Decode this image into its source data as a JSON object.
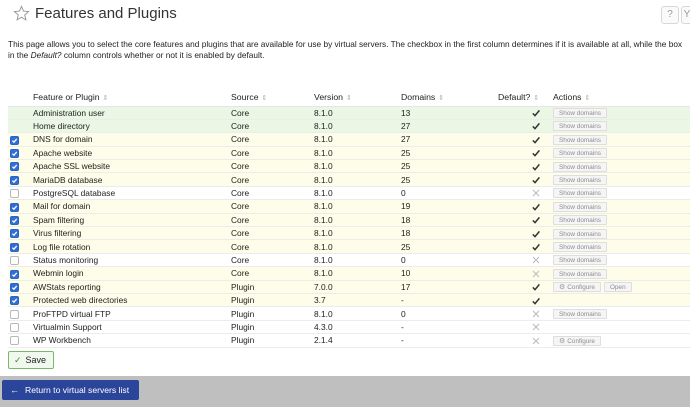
{
  "header": {
    "title": "Features and Plugins",
    "help_label": "?",
    "search_label": "Y"
  },
  "description": {
    "text_before": "This page allows you to select the core features and plugins that are available for use by virtual servers. The checkbox in the first column determines if it is available at all, while the box in the ",
    "emphasis": "Default?",
    "text_after": " column controls whether or not it is enabled by default."
  },
  "table": {
    "columns": [
      "Feature or Plugin",
      "Source",
      "Version",
      "Domains",
      "Default?",
      "Actions"
    ],
    "rows": [
      {
        "enabled": null,
        "name": "Administration user",
        "source": "Core",
        "version": "8.1.0",
        "domains": "13",
        "default": "check",
        "actions": [
          "Show domains"
        ],
        "tint": "green"
      },
      {
        "enabled": null,
        "name": "Home directory",
        "source": "Core",
        "version": "8.1.0",
        "domains": "27",
        "default": "check",
        "actions": [
          "Show domains"
        ],
        "tint": "green"
      },
      {
        "enabled": true,
        "name": "DNS for domain",
        "source": "Core",
        "version": "8.1.0",
        "domains": "27",
        "default": "check",
        "actions": [
          "Show domains"
        ],
        "tint": "yellow"
      },
      {
        "enabled": true,
        "name": "Apache website",
        "source": "Core",
        "version": "8.1.0",
        "domains": "25",
        "default": "check",
        "actions": [
          "Show domains"
        ],
        "tint": "yellow"
      },
      {
        "enabled": true,
        "name": "Apache SSL website",
        "source": "Core",
        "version": "8.1.0",
        "domains": "25",
        "default": "check",
        "actions": [
          "Show domains"
        ],
        "tint": "yellow"
      },
      {
        "enabled": true,
        "name": "MariaDB database",
        "source": "Core",
        "version": "8.1.0",
        "domains": "25",
        "default": "check",
        "actions": [
          "Show domains"
        ],
        "tint": "yellow"
      },
      {
        "enabled": false,
        "name": "PostgreSQL database",
        "source": "Core",
        "version": "8.1.0",
        "domains": "0",
        "default": "cross",
        "actions": [
          "Show domains"
        ],
        "tint": "white"
      },
      {
        "enabled": true,
        "name": "Mail for domain",
        "source": "Core",
        "version": "8.1.0",
        "domains": "19",
        "default": "check",
        "actions": [
          "Show domains"
        ],
        "tint": "yellow"
      },
      {
        "enabled": true,
        "name": "Spam filtering",
        "source": "Core",
        "version": "8.1.0",
        "domains": "18",
        "default": "check",
        "actions": [
          "Show domains"
        ],
        "tint": "yellow"
      },
      {
        "enabled": true,
        "name": "Virus filtering",
        "source": "Core",
        "version": "8.1.0",
        "domains": "18",
        "default": "check",
        "actions": [
          "Show domains"
        ],
        "tint": "yellow"
      },
      {
        "enabled": true,
        "name": "Log file rotation",
        "source": "Core",
        "version": "8.1.0",
        "domains": "25",
        "default": "check",
        "actions": [
          "Show domains"
        ],
        "tint": "yellow"
      },
      {
        "enabled": false,
        "name": "Status monitoring",
        "source": "Core",
        "version": "8.1.0",
        "domains": "0",
        "default": "cross",
        "actions": [
          "Show domains"
        ],
        "tint": "white"
      },
      {
        "enabled": true,
        "name": "Webmin login",
        "source": "Core",
        "version": "8.1.0",
        "domains": "10",
        "default": "cross",
        "actions": [
          "Show domains"
        ],
        "tint": "yellow"
      },
      {
        "enabled": true,
        "name": "AWStats reporting",
        "source": "Plugin",
        "version": "7.0.0",
        "domains": "17",
        "default": "check",
        "actions": [
          "Configure",
          "Open"
        ],
        "tint": "yellow"
      },
      {
        "enabled": true,
        "name": "Protected web directories",
        "source": "Plugin",
        "version": "3.7",
        "domains": "-",
        "default": "check",
        "actions": [],
        "tint": "yellow"
      },
      {
        "enabled": false,
        "name": "ProFTPD virtual FTP",
        "source": "Plugin",
        "version": "8.1.0",
        "domains": "0",
        "default": "cross",
        "actions": [
          "Show domains"
        ],
        "tint": "white"
      },
      {
        "enabled": false,
        "name": "Virtualmin Support",
        "source": "Plugin",
        "version": "4.3.0",
        "domains": "-",
        "default": "cross",
        "actions": [],
        "tint": "white"
      },
      {
        "enabled": false,
        "name": "WP Workbench",
        "source": "Plugin",
        "version": "2.1.4",
        "domains": "-",
        "default": "cross",
        "actions": [
          "Configure"
        ],
        "tint": "white"
      }
    ]
  },
  "save_label": "Save",
  "return_label": "Return to virtual servers list",
  "colors": {
    "checkbox_blue": "#2f6fd6",
    "row_green": "#e9f7e4",
    "row_yellow": "#fdfde9",
    "footer_gray": "#bfbfbf",
    "return_button": "#2a459a"
  }
}
